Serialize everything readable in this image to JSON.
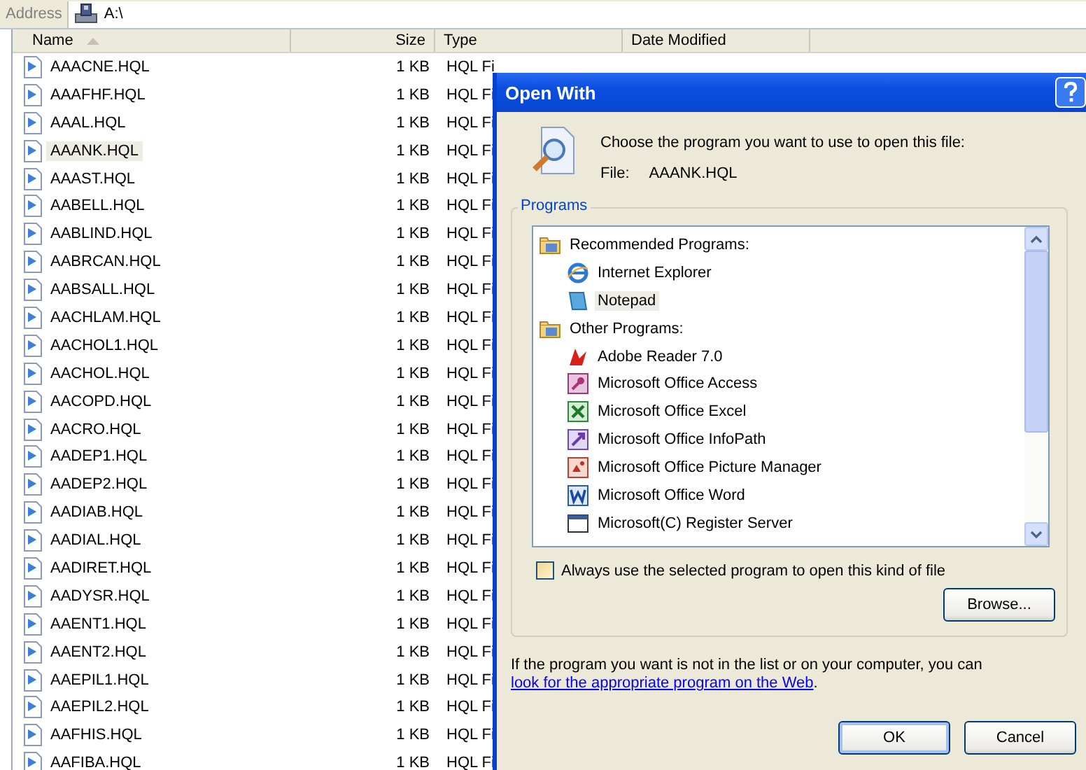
{
  "address_bar": {
    "label": "Address",
    "path": "A:\\"
  },
  "file_list": {
    "columns": [
      {
        "label": "Name",
        "sorted": true
      },
      {
        "label": "Size",
        "sorted": false
      },
      {
        "label": "Type",
        "sorted": false
      },
      {
        "label": "Date Modified",
        "sorted": false
      }
    ],
    "rows": [
      {
        "name": "AAACNE.HQL",
        "size": "1 KB",
        "type": "HQL Fi",
        "selected": false
      },
      {
        "name": "AAAFHF.HQL",
        "size": "1 KB",
        "type": "HQL Fi",
        "selected": false
      },
      {
        "name": "AAAL.HQL",
        "size": "1 KB",
        "type": "HQL Fi",
        "selected": false
      },
      {
        "name": "AAANK.HQL",
        "size": "1 KB",
        "type": "HQL Fi",
        "selected": true
      },
      {
        "name": "AAAST.HQL",
        "size": "1 KB",
        "type": "HQL Fi",
        "selected": false
      },
      {
        "name": "AABELL.HQL",
        "size": "1 KB",
        "type": "HQL Fi",
        "selected": false
      },
      {
        "name": "AABLIND.HQL",
        "size": "1 KB",
        "type": "HQL Fi",
        "selected": false
      },
      {
        "name": "AABRCAN.HQL",
        "size": "1 KB",
        "type": "HQL Fi",
        "selected": false
      },
      {
        "name": "AABSALL.HQL",
        "size": "1 KB",
        "type": "HQL Fi",
        "selected": false
      },
      {
        "name": "AACHLAM.HQL",
        "size": "1 KB",
        "type": "HQL Fi",
        "selected": false
      },
      {
        "name": "AACHOL1.HQL",
        "size": "1 KB",
        "type": "HQL Fi",
        "selected": false
      },
      {
        "name": "AACHOL.HQL",
        "size": "1 KB",
        "type": "HQL Fi",
        "selected": false
      },
      {
        "name": "AACOPD.HQL",
        "size": "1 KB",
        "type": "HQL Fi",
        "selected": false
      },
      {
        "name": "AACRO.HQL",
        "size": "1 KB",
        "type": "HQL Fi",
        "selected": false
      },
      {
        "name": "AADEP1.HQL",
        "size": "1 KB",
        "type": "HQL Fi",
        "selected": false
      },
      {
        "name": "AADEP2.HQL",
        "size": "1 KB",
        "type": "HQL Fi",
        "selected": false
      },
      {
        "name": "AADIAB.HQL",
        "size": "1 KB",
        "type": "HQL Fi",
        "selected": false
      },
      {
        "name": "AADIAL.HQL",
        "size": "1 KB",
        "type": "HQL Fi",
        "selected": false
      },
      {
        "name": "AADIRET.HQL",
        "size": "1 KB",
        "type": "HQL Fi",
        "selected": false
      },
      {
        "name": "AADYSR.HQL",
        "size": "1 KB",
        "type": "HQL Fi",
        "selected": false
      },
      {
        "name": "AAENT1.HQL",
        "size": "1 KB",
        "type": "HQL Fi",
        "selected": false
      },
      {
        "name": "AAENT2.HQL",
        "size": "1 KB",
        "type": "HQL Fi",
        "selected": false
      },
      {
        "name": "AAEPIL1.HQL",
        "size": "1 KB",
        "type": "HQL Fi",
        "selected": false
      },
      {
        "name": "AAEPIL2.HQL",
        "size": "1 KB",
        "type": "HQL Fi",
        "selected": false
      },
      {
        "name": "AAFHIS.HQL",
        "size": "1 KB",
        "type": "HQL Fi",
        "selected": false
      },
      {
        "name": "AAFIBA.HQL",
        "size": "1 KB",
        "type": "HQL Fi",
        "selected": false
      }
    ]
  },
  "dialog": {
    "title": "Open With",
    "prompt": "Choose the program you want to use to open this file:",
    "file_label": "File:",
    "file_name": "AAANK.HQL",
    "programs_group": {
      "label": "Programs",
      "items": [
        {
          "kind": "group",
          "label": "Recommended Programs:",
          "selected": false
        },
        {
          "kind": "program",
          "label": "Internet Explorer",
          "selected": false
        },
        {
          "kind": "program",
          "label": "Notepad",
          "selected": true
        },
        {
          "kind": "group",
          "label": "Other Programs:",
          "selected": false
        },
        {
          "kind": "program",
          "label": "Adobe Reader 7.0",
          "selected": false
        },
        {
          "kind": "program",
          "label": "Microsoft Office Access",
          "selected": false
        },
        {
          "kind": "program",
          "label": "Microsoft Office Excel",
          "selected": false
        },
        {
          "kind": "program",
          "label": "Microsoft Office InfoPath",
          "selected": false
        },
        {
          "kind": "program",
          "label": "Microsoft Office Picture Manager",
          "selected": false
        },
        {
          "kind": "program",
          "label": "Microsoft Office Word",
          "selected": false
        },
        {
          "kind": "program",
          "label": "Microsoft(C) Register Server",
          "selected": false
        }
      ],
      "always_use": {
        "label": "Always use the selected program to open this kind of file",
        "checked": false
      },
      "browse_button": "Browse..."
    },
    "help_text": "If the program you want is not in the list or on your computer, you can",
    "help_link": "look for the appropriate program on the Web",
    "help_end": ".",
    "buttons": [
      {
        "label": "OK",
        "default": true
      },
      {
        "label": "Cancel",
        "default": false
      }
    ]
  }
}
